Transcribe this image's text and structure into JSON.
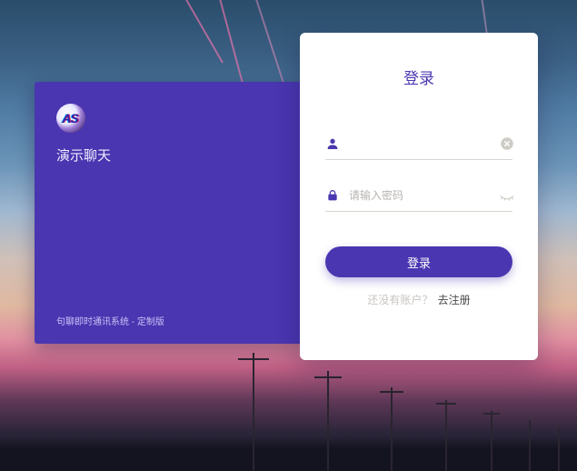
{
  "brand": {
    "logo_letters": "AS",
    "title": "演示聊天",
    "footer": "句聊即时通讯系统 - 定制版"
  },
  "login": {
    "title": "登录",
    "username": {
      "value": "",
      "placeholder": ""
    },
    "password": {
      "value": "",
      "placeholder": "请输入密码"
    },
    "submit_label": "登录",
    "no_account_text": "还没有账户？",
    "register_link": "去注册"
  },
  "colors": {
    "accent": "#4a36b0"
  }
}
